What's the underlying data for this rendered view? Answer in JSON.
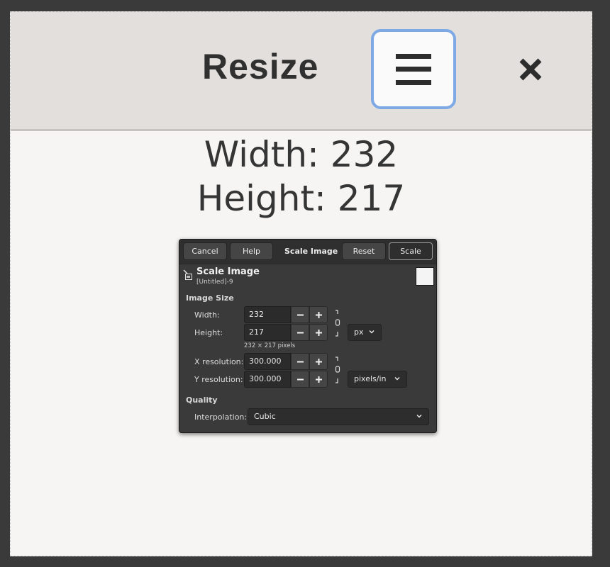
{
  "app": {
    "title": "Resize",
    "menu_icon": "hamburger-menu-icon",
    "close_icon": "close-icon",
    "width_text": "Width: 232",
    "height_text": "Height: 217"
  },
  "dialog": {
    "buttons": {
      "cancel": "Cancel",
      "help": "Help",
      "title": "Scale Image",
      "reset": "Reset",
      "scale": "Scale"
    },
    "header": {
      "title": "Scale Image",
      "subtitle": "[Untitled]-9"
    },
    "image_size": {
      "section_label": "Image Size",
      "width_label": "Width:",
      "width_value": "232",
      "height_label": "Height:",
      "height_value": "217",
      "unit": "px",
      "pixels_caption": "232 × 217 pixels",
      "x_res_label": "X resolution:",
      "x_res_value": "300.000",
      "y_res_label": "Y resolution:",
      "y_res_value": "300.000",
      "res_unit": "pixels/in"
    },
    "quality": {
      "section_label": "Quality",
      "interpolation_label": "Interpolation:",
      "interpolation_value": "Cubic"
    }
  },
  "colors": {
    "focus_ring": "#7fa9e4",
    "dialog_bg": "#3a3a3a",
    "header_bg": "#e2dfdc"
  }
}
